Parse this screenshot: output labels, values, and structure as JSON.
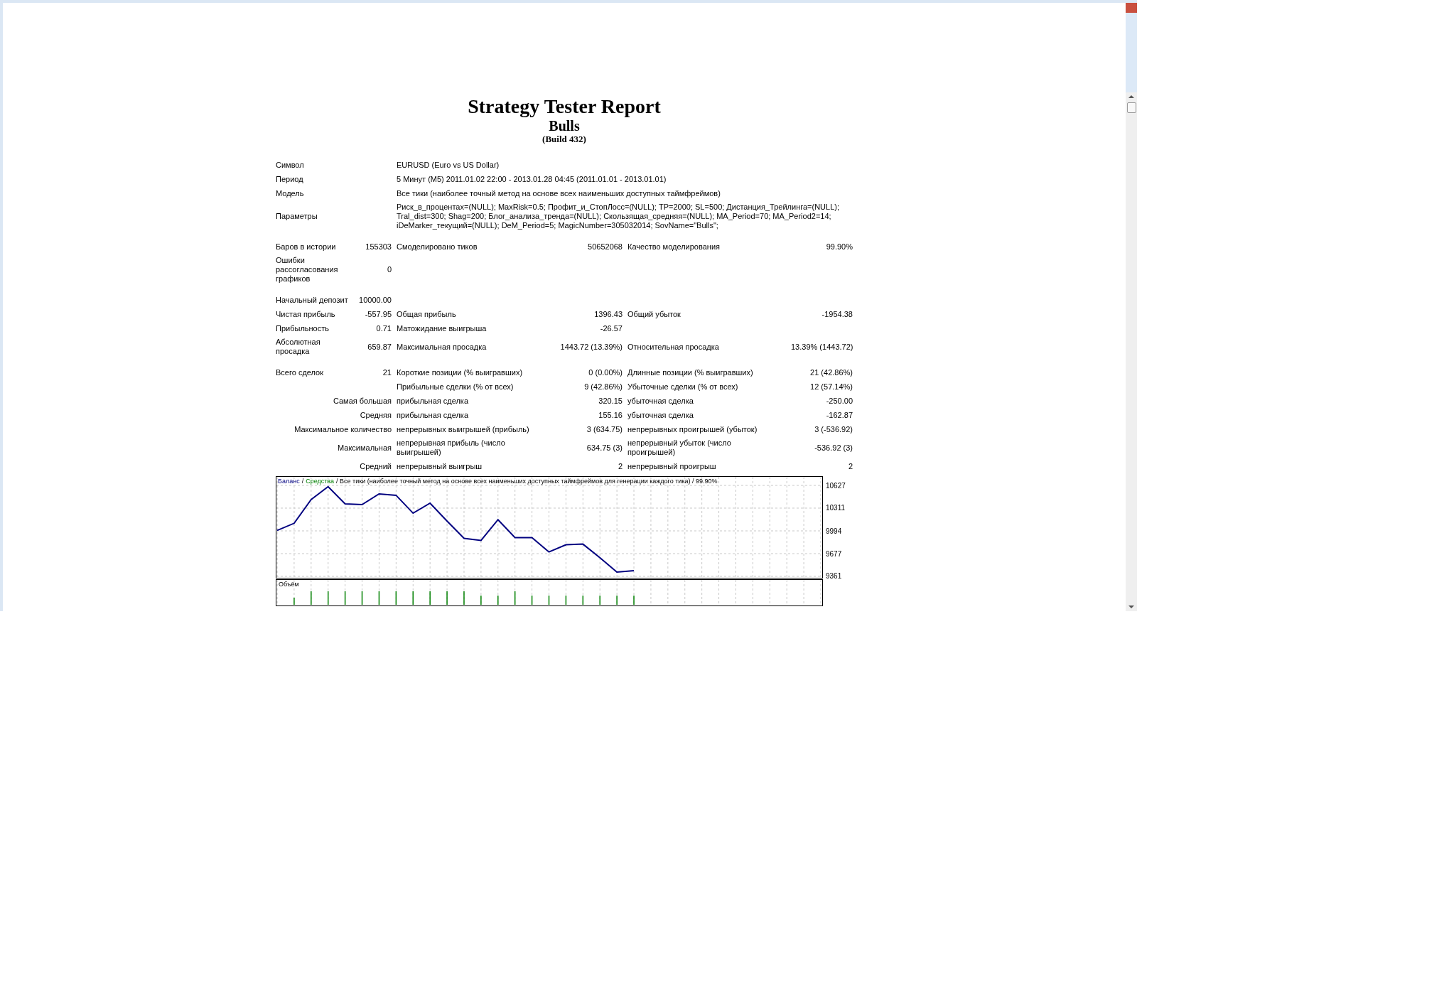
{
  "report": {
    "title": "Strategy Tester Report",
    "subtitle": "Bulls",
    "build": "(Build 432)"
  },
  "sections": [
    [
      {
        "kind": "info",
        "label": "Символ",
        "value": "EURUSD (Euro vs US Dollar)"
      },
      {
        "kind": "info",
        "label": "Период",
        "value": "5 Минут (M5) 2011.01.02 22:00 - 2013.01.28 04:45 (2011.01.01 - 2013.01.01)"
      },
      {
        "kind": "info",
        "label": "Модель",
        "value": "Все тики (наиболее точный метод на основе всех наименьших доступных таймфреймов)"
      },
      {
        "kind": "info",
        "label": "Параметры",
        "value": "Риск_в_процентах=(NULL); MaxRisk=0.5; Профит_и_СтопЛосс=(NULL); TP=2000; SL=500; Дистанция_Трейлинга=(NULL); Tral_dist=300; Shag=200; Блог_анализа_тренда=(NULL); Скользящая_средняя=(NULL); MA_Period=70; MA_Period2=14; iDeMarker_текущий=(NULL); DeM_Period=5; MagicNumber=305032014; SovName=\"Bulls\";"
      }
    ],
    [
      {
        "kind": "plain",
        "label": "Баров в истории",
        "value": "155303",
        "label2": "Смоделировано тиков",
        "value2": "50652068",
        "label3": "Качество моделирования",
        "value3": "99.90%"
      },
      {
        "kind": "plain",
        "label": "Ошибки рассогласования графиков",
        "value": "0"
      }
    ],
    [
      {
        "kind": "plain",
        "label": "Начальный депозит",
        "value": "10000.00"
      },
      {
        "kind": "plain",
        "label": "Чистая прибыль",
        "value": "-557.95",
        "label2": "Общая прибыль",
        "value2": "1396.43",
        "label3": "Общий убыток",
        "value3": "-1954.38"
      },
      {
        "kind": "plain",
        "label": "Прибыльность",
        "value": "0.71",
        "label2": "Матожидание выигрыша",
        "value2": "-26.57"
      },
      {
        "kind": "plain",
        "label": "Абсолютная просадка",
        "value": "659.87",
        "label2": "Максимальная просадка",
        "value2": "1443.72 (13.39%)",
        "label3": "Относительная просадка",
        "value3": "13.39% (1443.72)"
      }
    ],
    [
      {
        "kind": "plain",
        "label": "Всего сделок",
        "value": "21",
        "label2": "Короткие позиции (% выигравших)",
        "value2": "0 (0.00%)",
        "label3": "Длинные позиции (% выигравших)",
        "value3": "21 (42.86%)"
      },
      {
        "kind": "plain",
        "label2": "Прибыльные сделки (% от всех)",
        "value2": "9 (42.86%)",
        "label3": "Убыточные сделки (% от всех)",
        "value3": "12 (57.14%)"
      },
      {
        "kind": "group",
        "label": "Самая большая",
        "label2": "прибыльная сделка",
        "value2": "320.15",
        "label3": "убыточная сделка",
        "value3": "-250.00"
      },
      {
        "kind": "group",
        "label": "Средняя",
        "label2": "прибыльная сделка",
        "value2": "155.16",
        "label3": "убыточная сделка",
        "value3": "-162.87"
      },
      {
        "kind": "group",
        "label": "Максимальное количество",
        "label2": "непрерывных выигрышей (прибыль)",
        "value2": "3 (634.75)",
        "label3": "непрерывных проигрышей (убыток)",
        "value3": "3 (-536.92)"
      },
      {
        "kind": "group",
        "label": "Максимальная",
        "label2": "непрерывная прибыль (число выигрышей)",
        "value2": "634.75 (3)",
        "label3": "непрерывный убыток (число проигрышей)",
        "value3": "-536.92 (3)"
      },
      {
        "kind": "group",
        "label": "Средний",
        "label2": "непрерывный выигрыш",
        "value2": "2",
        "label3": "непрерывный проигрыш",
        "value3": "2"
      }
    ]
  ],
  "chart": {
    "legend": [
      {
        "kind": "separator",
        "text": "/"
      },
      {
        "kind": "equity",
        "text": "Средства"
      },
      {
        "kind": "note",
        "text": "/ Все тики (наиболее точный метод на основе всех наименьших доступных таймфреймов для генерации каждого тика) / 99.90%"
      }
    ],
    "volume_label": "Объём",
    "chart_data": {
      "type": "line",
      "categories": [
        null,
        null,
        null,
        null,
        null,
        null,
        null,
        null,
        null,
        null,
        null,
        null,
        null,
        null,
        null,
        null,
        null,
        null,
        null,
        null,
        null,
        null,
        null,
        null,
        null,
        null,
        null,
        null,
        null,
        null,
        null,
        null,
        null
      ],
      "series": [
        {
          "name": "Баланс",
          "color": "#000080",
          "values": [
            10000,
            10100,
            10430,
            10610,
            10370,
            10360,
            10510,
            10490,
            10240,
            10380,
            10130,
            9890,
            9860,
            10150,
            9900,
            9900,
            9700,
            9800,
            9810,
            9620,
            9420,
            9440,
            null,
            null,
            null,
            null,
            null,
            null,
            null,
            null,
            null,
            null,
            null
          ]
        }
      ],
      "ylim": [
        9341,
        10756
      ],
      "yticks": [
        9361,
        9677,
        9994,
        10311,
        10627
      ],
      "grid": true
    }
  }
}
